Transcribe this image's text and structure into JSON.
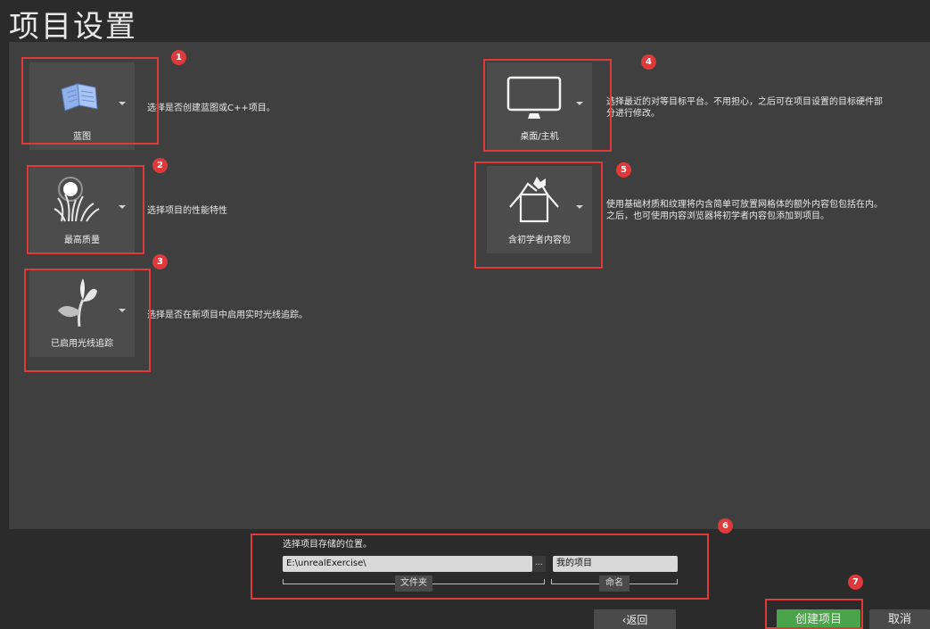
{
  "page_title": "项目设置",
  "options": {
    "blueprint": {
      "label": "蓝图",
      "desc": "选择是否创建蓝图或C++项目。"
    },
    "quality": {
      "label": "最高质量",
      "desc": "选择项目的性能特性"
    },
    "raytracing": {
      "label": "已启用光线追踪",
      "desc": "选择是否在新项目中启用实时光线追踪。"
    },
    "platform": {
      "label": "桌面/主机",
      "desc_line1": "选择最近的对等目标平台。不用担心，之后可在项目设置的目标硬件部",
      "desc_line2": "分进行修改。"
    },
    "starter": {
      "label": "含初学者内容包",
      "desc_line1": "使用基础材质和纹理将内含简单可放置网格体的额外内容包包括在内。",
      "desc_line2": "之后，也可使用内容浏览器将初学者内容包添加到项目。"
    }
  },
  "location": {
    "label": "选择项目存储的位置。",
    "folder_value": "E:\\unrealExercise\\",
    "browse_label": "...",
    "name_value": "我的项目",
    "folder_caption": "文件夹",
    "name_caption": "命名"
  },
  "buttons": {
    "back": "‹返回",
    "create": "创建项目",
    "cancel": "取消"
  },
  "badges": [
    "1",
    "2",
    "3",
    "4",
    "5",
    "6",
    "7"
  ],
  "colors": {
    "highlight": "#e0393b",
    "create_button": "#4aa44a",
    "panel": "#3f3f3f"
  }
}
